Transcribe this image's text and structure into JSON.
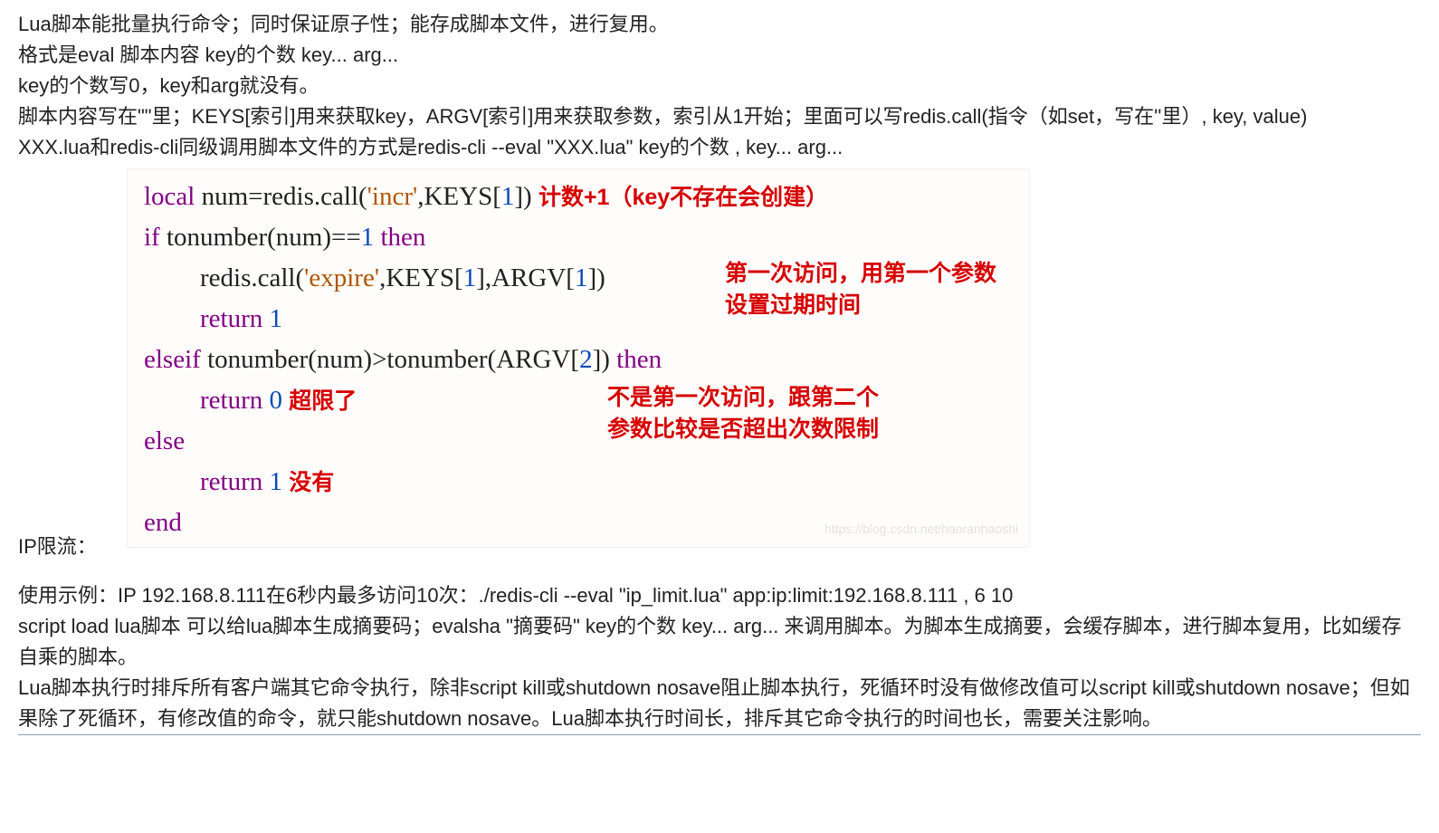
{
  "paras_top": [
    "Lua脚本能批量执行命令；同时保证原子性；能存成脚本文件，进行复用。",
    "格式是eval 脚本内容 key的个数 key... arg...",
    "key的个数写0，key和arg就没有。",
    "脚本内容写在\"\"里；KEYS[索引]用来获取key，ARGV[索引]用来获取参数，索引从1开始；里面可以写redis.call(指令（如set，写在''里）, key, value)",
    "XXX.lua和redis-cli同级调用脚本文件的方式是redis-cli --eval \"XXX.lua\" key的个数 , key... arg..."
  ],
  "code": {
    "l1": {
      "kw": "local",
      "rest1": " num=redis.call(",
      "str": "'incr'",
      "rest2": ",KEYS[",
      "n": "1",
      "rest3": "]) ",
      "ann": "计数+1（key不存在会创建）"
    },
    "l2": {
      "kw": "if",
      "rest1": " tonumber(num)==",
      "n": "1",
      "kw2": " then"
    },
    "l3": {
      "rest1": "redis.call(",
      "str": "'expire'",
      "rest2": ",KEYS[",
      "n1": "1",
      "rest3": "],ARGV[",
      "n2": "1",
      "rest4": "]) "
    },
    "ann_float1": "第一次访问，用第一个参数",
    "ann_float1b": "设置过期时间",
    "l4": {
      "kw": "return",
      "sp": " ",
      "n": "1"
    },
    "l5": {
      "kw": "elseif",
      "rest1": " tonumber(num)>tonumber(ARGV[",
      "n": "2",
      "rest2": "]) ",
      "kw2": "then"
    },
    "l6": {
      "kw": "return",
      "sp": " ",
      "n": "0",
      "sp2": " ",
      "ann": "超限了"
    },
    "ann_float2": "不是第一次访问，跟第二个",
    "ann_float2b": "参数比较是否超出次数限制",
    "l7": {
      "kw": "else"
    },
    "l8": {
      "kw": "return",
      "sp": " ",
      "n": "1",
      "sp2": " ",
      "ann": "没有"
    },
    "l9": {
      "kw": "end"
    }
  },
  "ip_label": "IP限流：",
  "paras_bottom": [
    "使用示例：IP 192.168.8.111在6秒内最多访问10次：./redis-cli --eval \"ip_limit.lua\" app:ip:limit:192.168.8.111 , 6 10",
    "script load lua脚本 可以给lua脚本生成摘要码；evalsha \"摘要码\" key的个数 key... arg... 来调用脚本。为脚本生成摘要，会缓存脚本，进行脚本复用，比如缓存自乘的脚本。",
    "Lua脚本执行时排斥所有客户端其它命令执行，除非script kill或shutdown nosave阻止脚本执行，死循环时没有做修改值可以script kill或shutdown nosave；但如果除了死循环，有修改值的命令，就只能shutdown nosave。Lua脚本执行时间长，排斥其它命令执行的时间也长，需要关注影响。"
  ],
  "watermark": "https://blog.csdn.net/haoranhaoshi"
}
